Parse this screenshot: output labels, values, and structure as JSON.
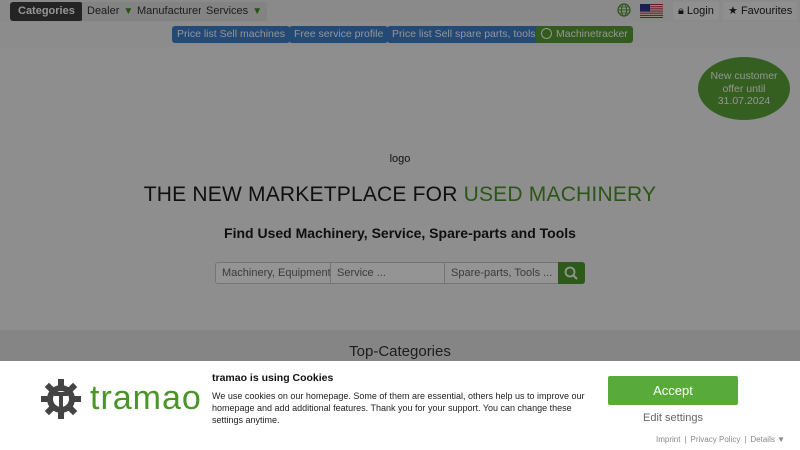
{
  "nav": {
    "categories": "Categories",
    "dealer": "Dealer",
    "manufacturer": "Manufacturer",
    "services": "Services",
    "dropdown_glyph": "▼",
    "login": "Login",
    "favourites": "Favourites",
    "login_icon": "lock-icon",
    "favourites_icon": "star-icon"
  },
  "subnav": {
    "price_list_sell_machines": "Price list Sell machines",
    "free_service_profile": "Free service profile",
    "price_list_sell_spare": "Price list Sell spare parts, tools",
    "machinetracker": "Machinetracker"
  },
  "offer": {
    "line1": "New customer",
    "line2": "offer until",
    "line3": "31.07.2024"
  },
  "hero": {
    "logo_alt": "logo",
    "headline_prefix": "THE NEW MARKETPLACE FOR ",
    "headline_accent": "USED MACHINERY",
    "subline": "Find Used Machinery, Service, Spare-parts and Tools"
  },
  "search": {
    "machinery_placeholder": "Machinery, Equipment,",
    "service_placeholder": "Service ...",
    "spare_placeholder": "Spare-parts, Tools ..."
  },
  "top_categories": "Top-Categories",
  "cookie": {
    "brand": "tramao",
    "title": "tramao is using Cookies",
    "text": "We use cookies on our homepage. Some of them are essential, others help us to improve our homepage and add additional features. Thank you for your support. You can change these settings anytime.",
    "accept": "Accept",
    "edit": "Edit settings",
    "imprint": "Imprint",
    "privacy": "Privacy Policy",
    "details": "Details ▼"
  },
  "colors": {
    "accent_green": "#4b9428",
    "button_blue": "#3d7fcc",
    "dark_button": "#3f3f3f"
  }
}
